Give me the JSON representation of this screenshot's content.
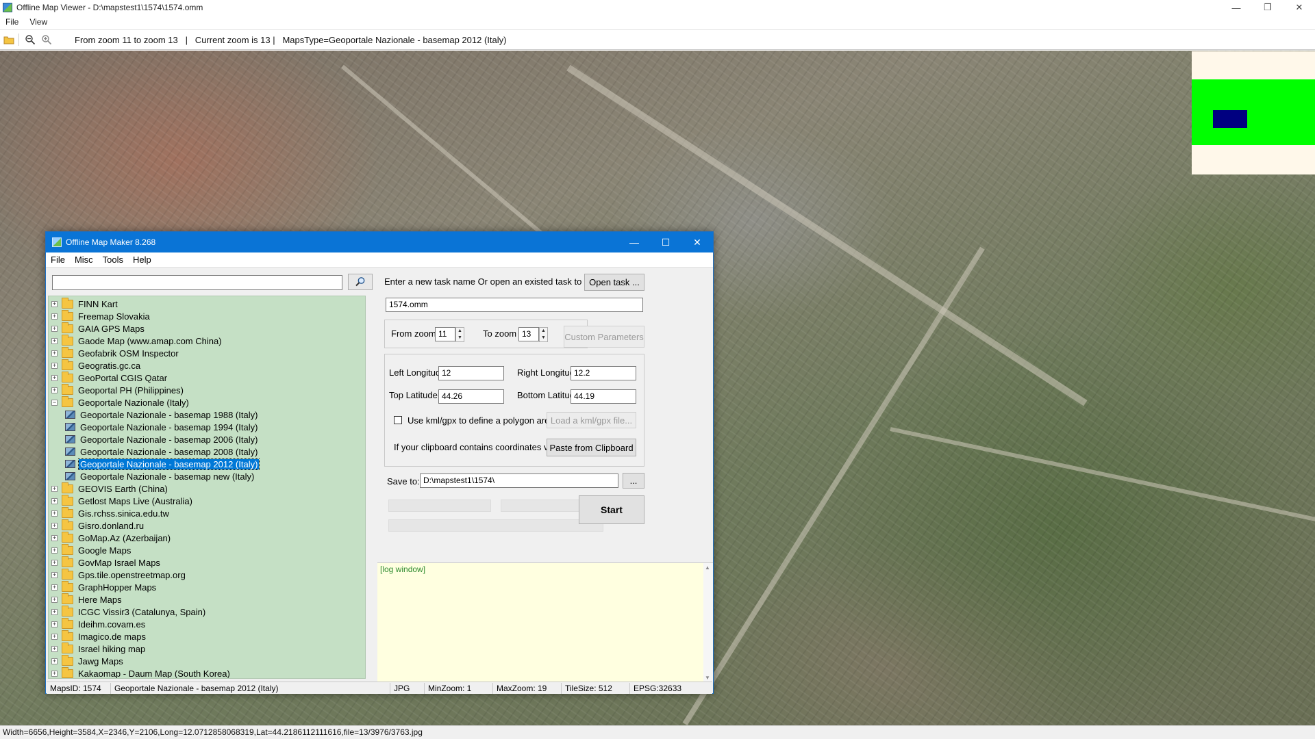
{
  "window": {
    "title": "Offline Map Viewer - D:\\mapstest1\\1574\\1574.omm",
    "controls": [
      "—",
      "❐",
      "✕"
    ]
  },
  "menu": [
    "File",
    "View"
  ],
  "toolbar": {
    "zoom_info": "From zoom 11 to zoom 13   |   Current zoom is 13 |   MapsType=Geoportale Nazionale - basemap 2012 (Italy)"
  },
  "status_bar": {
    "text": "Width=6656,Height=3584,X=2346,Y=2106,Long=12.0712858068319,Lat=44.2186112111616,file=13/3976/3763.jpg"
  },
  "minimap": {
    "colors": {
      "background": "#fff8ea",
      "coverage": "#00ff00",
      "viewport": "#000080"
    }
  },
  "dialog": {
    "title": "Offline Map Maker 8.268",
    "controls": [
      "—",
      "☐",
      "✕"
    ],
    "menu": [
      "File",
      "Misc",
      "Tools",
      "Help"
    ],
    "search": {
      "value": "",
      "placeholder": ""
    },
    "tree": [
      {
        "label": "FINN Kart",
        "type": "folder",
        "expander": "+"
      },
      {
        "label": "Freemap Slovakia",
        "type": "folder",
        "expander": "+"
      },
      {
        "label": "GAIA GPS Maps",
        "type": "folder",
        "expander": "+"
      },
      {
        "label": "Gaode Map (www.amap.com China)",
        "type": "folder",
        "expander": "+"
      },
      {
        "label": "Geofabrik OSM Inspector",
        "type": "folder",
        "expander": "+"
      },
      {
        "label": "Geogratis.gc.ca",
        "type": "folder",
        "expander": "+"
      },
      {
        "label": "GeoPortal CGIS Qatar",
        "type": "folder",
        "expander": "+"
      },
      {
        "label": "Geoportal PH (Philippines)",
        "type": "folder",
        "expander": "+"
      },
      {
        "label": "Geoportale Nazionale (Italy)",
        "type": "folder-open",
        "expander": "−"
      },
      {
        "label": "Geoportale Nazionale - basemap 1988 (Italy)",
        "type": "map",
        "expander": ""
      },
      {
        "label": "Geoportale Nazionale - basemap 1994 (Italy)",
        "type": "map",
        "expander": ""
      },
      {
        "label": "Geoportale Nazionale - basemap 2006 (Italy)",
        "type": "map",
        "expander": ""
      },
      {
        "label": "Geoportale Nazionale - basemap 2008 (Italy)",
        "type": "map",
        "expander": ""
      },
      {
        "label": "Geoportale Nazionale - basemap 2012 (Italy)",
        "type": "map",
        "expander": "",
        "selected": true
      },
      {
        "label": "Geoportale Nazionale - basemap new (Italy)",
        "type": "map",
        "expander": ""
      },
      {
        "label": "GEOVIS Earth (China)",
        "type": "folder",
        "expander": "+"
      },
      {
        "label": "Getlost Maps Live (Australia)",
        "type": "folder",
        "expander": "+"
      },
      {
        "label": "Gis.rchss.sinica.edu.tw",
        "type": "folder",
        "expander": "+"
      },
      {
        "label": "Gisro.donland.ru",
        "type": "folder",
        "expander": "+"
      },
      {
        "label": "GoMap.Az (Azerbaijan)",
        "type": "folder",
        "expander": "+"
      },
      {
        "label": "Google Maps",
        "type": "folder",
        "expander": "+"
      },
      {
        "label": "GovMap Israel Maps",
        "type": "folder",
        "expander": "+"
      },
      {
        "label": "Gps.tile.openstreetmap.org",
        "type": "folder",
        "expander": "+"
      },
      {
        "label": "GraphHopper Maps",
        "type": "folder",
        "expander": "+"
      },
      {
        "label": "Here Maps",
        "type": "folder",
        "expander": "+"
      },
      {
        "label": "ICGC Vissir3 (Catalunya, Spain)",
        "type": "folder",
        "expander": "+"
      },
      {
        "label": "Ideihm.covam.es",
        "type": "folder",
        "expander": "+"
      },
      {
        "label": "Imagico.de maps",
        "type": "folder",
        "expander": "+"
      },
      {
        "label": "Israel hiking map",
        "type": "folder",
        "expander": "+"
      },
      {
        "label": "Jawg Maps",
        "type": "folder",
        "expander": "+"
      },
      {
        "label": "Kakaomap - Daum Map (South Korea)",
        "type": "folder",
        "expander": "+"
      }
    ],
    "task": {
      "prompt": "Enter a new task name Or open an existed task to continue:",
      "open_button": "Open task ...",
      "name": "1574.omm"
    },
    "zoom": {
      "from_label": "From zoom",
      "from_value": "11",
      "to_label": "To zoom",
      "to_value": "13",
      "custom_button": "Custom Parameters"
    },
    "bounds": {
      "left_lon_label": "Left Longitude",
      "left_lon": "12",
      "right_lon_label": "Right Longitude",
      "right_lon": "12.2",
      "top_lat_label": "Top Latitude",
      "top_lat": "44.26",
      "bottom_lat_label": "Bottom Latitude",
      "bottom_lat": "44.19",
      "kml_label": "Use kml/gpx to define a polygon area",
      "kml_button": "Load a kml/gpx file...",
      "clipboard_label": "If your clipboard contains coordinates values:",
      "clipboard_button": "Paste from Clipboard"
    },
    "save": {
      "label": "Save to:",
      "path": "D:\\mapstest1\\1574\\",
      "browse": "..."
    },
    "start_button": "Start",
    "log": "[log window]",
    "status": {
      "maps_id": "MapsID: 1574",
      "maps_name": "Geoportale Nazionale - basemap 2012 (Italy)",
      "format": "JPG",
      "min_zoom": "MinZoom: 1",
      "max_zoom": "MaxZoom: 19",
      "tile_size": "TileSize: 512",
      "epsg": "EPSG:32633"
    }
  }
}
